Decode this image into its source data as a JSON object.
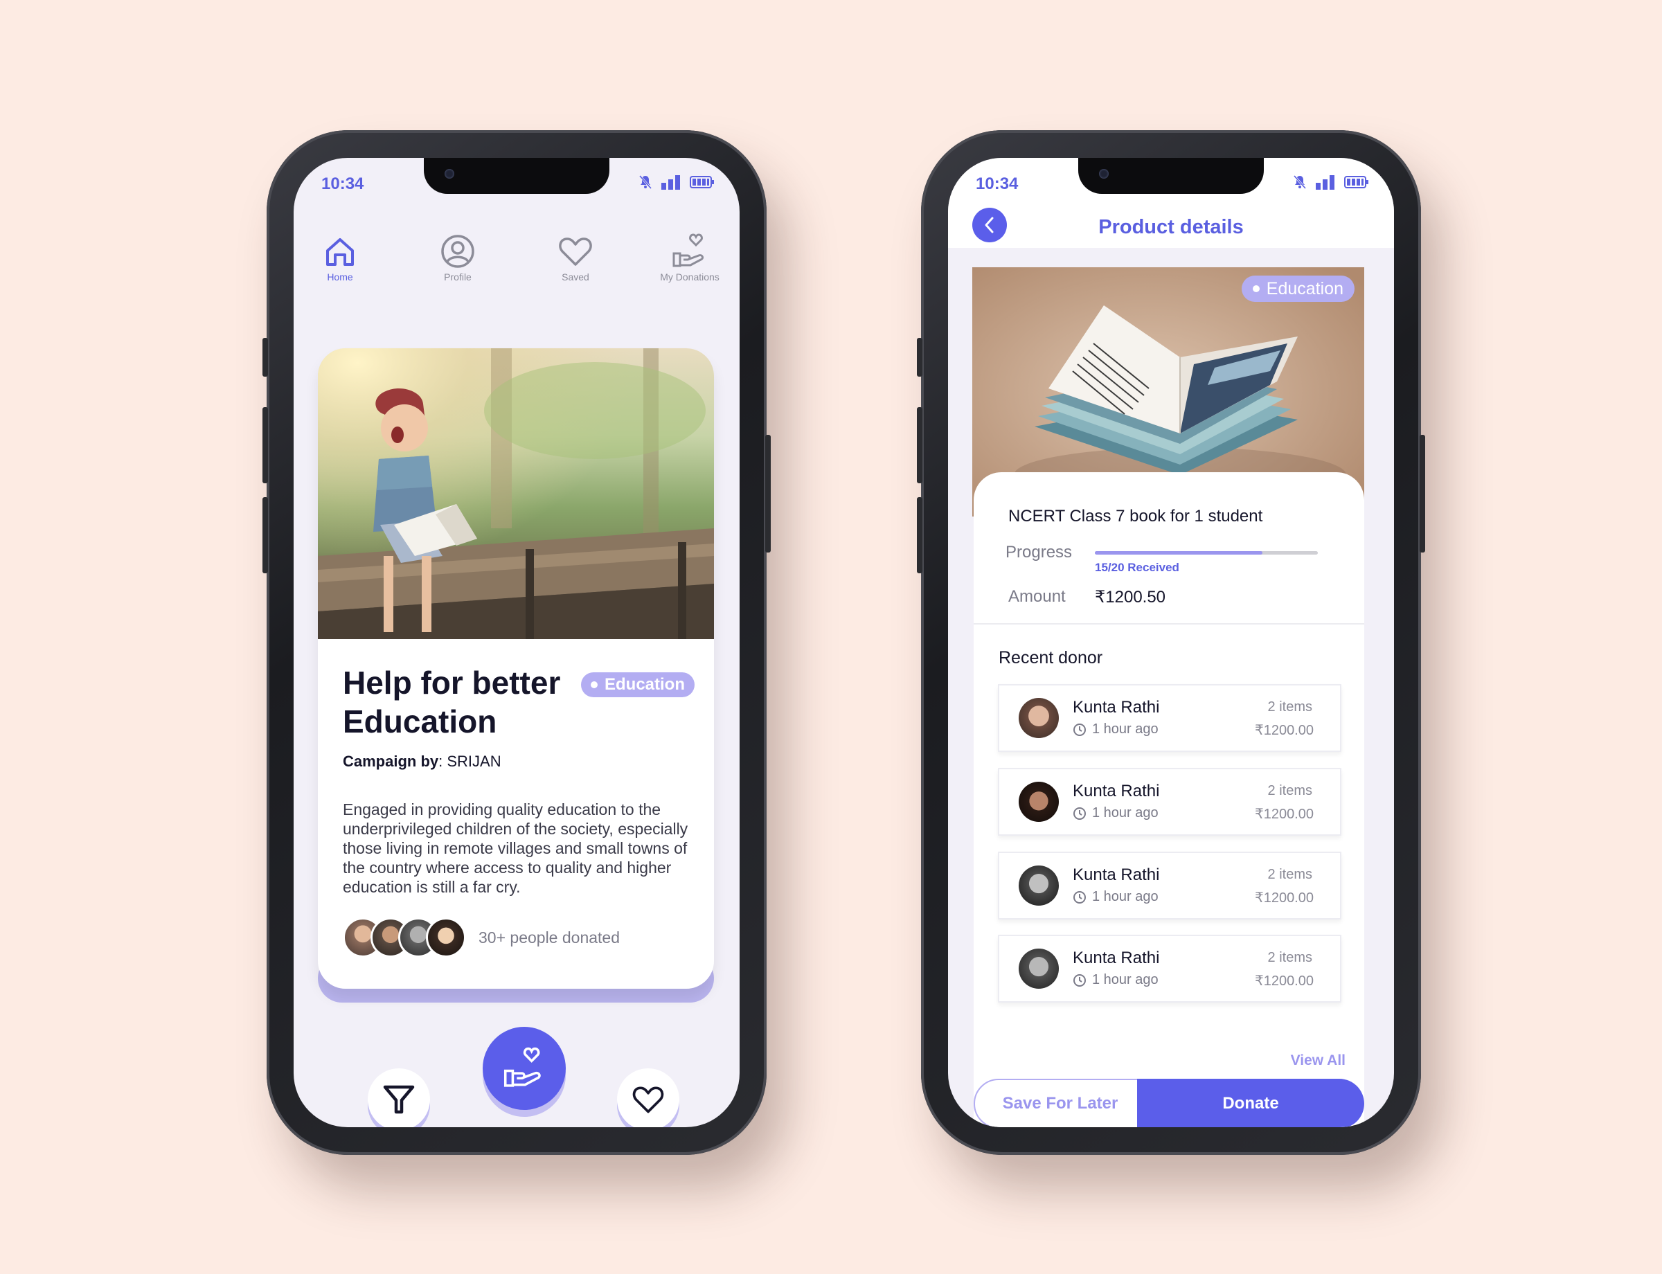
{
  "left_phone": {
    "status": {
      "time": "10:34"
    },
    "nav": [
      {
        "label": "Home",
        "icon": "home-icon",
        "active": true
      },
      {
        "label": "Profile",
        "icon": "profile-icon",
        "active": false
      },
      {
        "label": "Saved",
        "icon": "heart-icon",
        "active": false
      },
      {
        "label": "My Donations",
        "icon": "donation-hand-icon",
        "active": false
      }
    ],
    "card": {
      "title": "Help for better Education",
      "badge": "Education",
      "campaign_label": "Campaign by",
      "campaign_value": ": SRIJAN",
      "description": "Engaged in providing quality education to the underprivileged children of the society, especially those living in remote villages and small towns of the country where access to quality and higher education is still a far cry.",
      "donated_text": "30+ people donated"
    },
    "bottom_actions": [
      "filter-icon",
      "donate-hand-icon",
      "heart-icon"
    ]
  },
  "right_phone": {
    "status": {
      "time": "10:34"
    },
    "page_title": "Product details",
    "badge": "Education",
    "product_name": "NCERT Class 7 book for 1 student",
    "progress_label": "Progress",
    "progress_fraction": 0.75,
    "progress_text": "15/20 Received",
    "amount_label": "Amount",
    "amount_value": "₹1200.50",
    "recent_donor_title": "Recent donor",
    "donors": [
      {
        "name": "Kunta Rathi",
        "time": "1 hour ago",
        "items": "2 items",
        "amount": "₹1200.00"
      },
      {
        "name": "Kunta Rathi",
        "time": "1 hour ago",
        "items": "2 items",
        "amount": "₹1200.00"
      },
      {
        "name": "Kunta Rathi",
        "time": "1 hour ago",
        "items": "2 items",
        "amount": "₹1200.00"
      },
      {
        "name": "Kunta Rathi",
        "time": "1 hour ago",
        "items": "2 items",
        "amount": "₹1200.00"
      }
    ],
    "view_all": "View All",
    "save_button": "Save For Later",
    "donate_button": "Donate"
  },
  "colors": {
    "accent": "#5b5eea",
    "accent_light": "#b3adf2",
    "background": "#fdebe3"
  }
}
